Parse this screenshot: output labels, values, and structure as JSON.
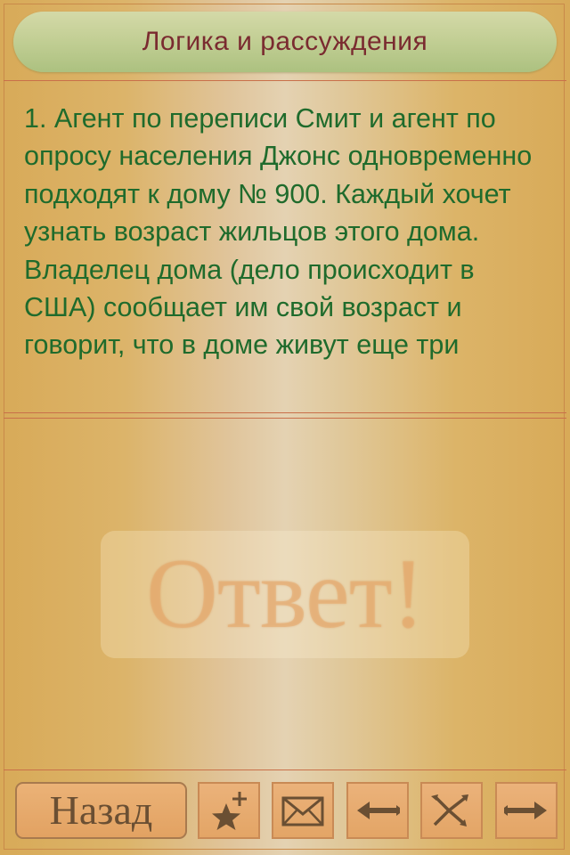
{
  "header": {
    "title": "Логика и рассуждения"
  },
  "question": {
    "text": "1.  Агент по переписи Смит и агент по опросу населения Джонс одновременно подходят к дому № 900. Каждый хочет узнать возраст жильцов этого дома. Владелец дома (дело происходит в США) сообщает им свой возраст и говорит, что в доме живут еще три"
  },
  "answer": {
    "label": "Ответ!"
  },
  "toolbar": {
    "back_label": "Назад",
    "buttons": [
      {
        "icon": "star-plus-icon"
      },
      {
        "icon": "envelope-icon"
      },
      {
        "icon": "arrow-left-icon"
      },
      {
        "icon": "shuffle-icon"
      },
      {
        "icon": "arrow-right-icon"
      }
    ]
  },
  "colors": {
    "title_text": "#7a2b30",
    "question_text": "#1f6b2c",
    "icon": "#6a4f33"
  }
}
